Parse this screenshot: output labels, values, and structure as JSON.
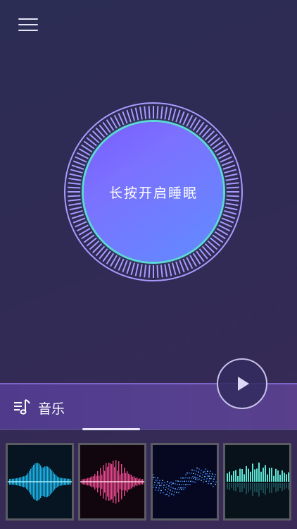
{
  "header": {
    "menu_icon": "hamburger-menu-icon"
  },
  "sleep": {
    "label": "长按开启睡眠"
  },
  "music": {
    "icon": "music-note-list-icon",
    "label": "音乐"
  },
  "player": {
    "icon": "play-icon"
  },
  "sounds": [
    {
      "icon": "cyan-waveform-image"
    },
    {
      "icon": "pink-waveform-image"
    },
    {
      "icon": "blue-particle-wave-image"
    },
    {
      "icon": "teal-equalizer-image"
    }
  ],
  "colors": {
    "accent": "#7b6cff",
    "ring": "#5fd7d8",
    "tick": "#a79bff"
  }
}
